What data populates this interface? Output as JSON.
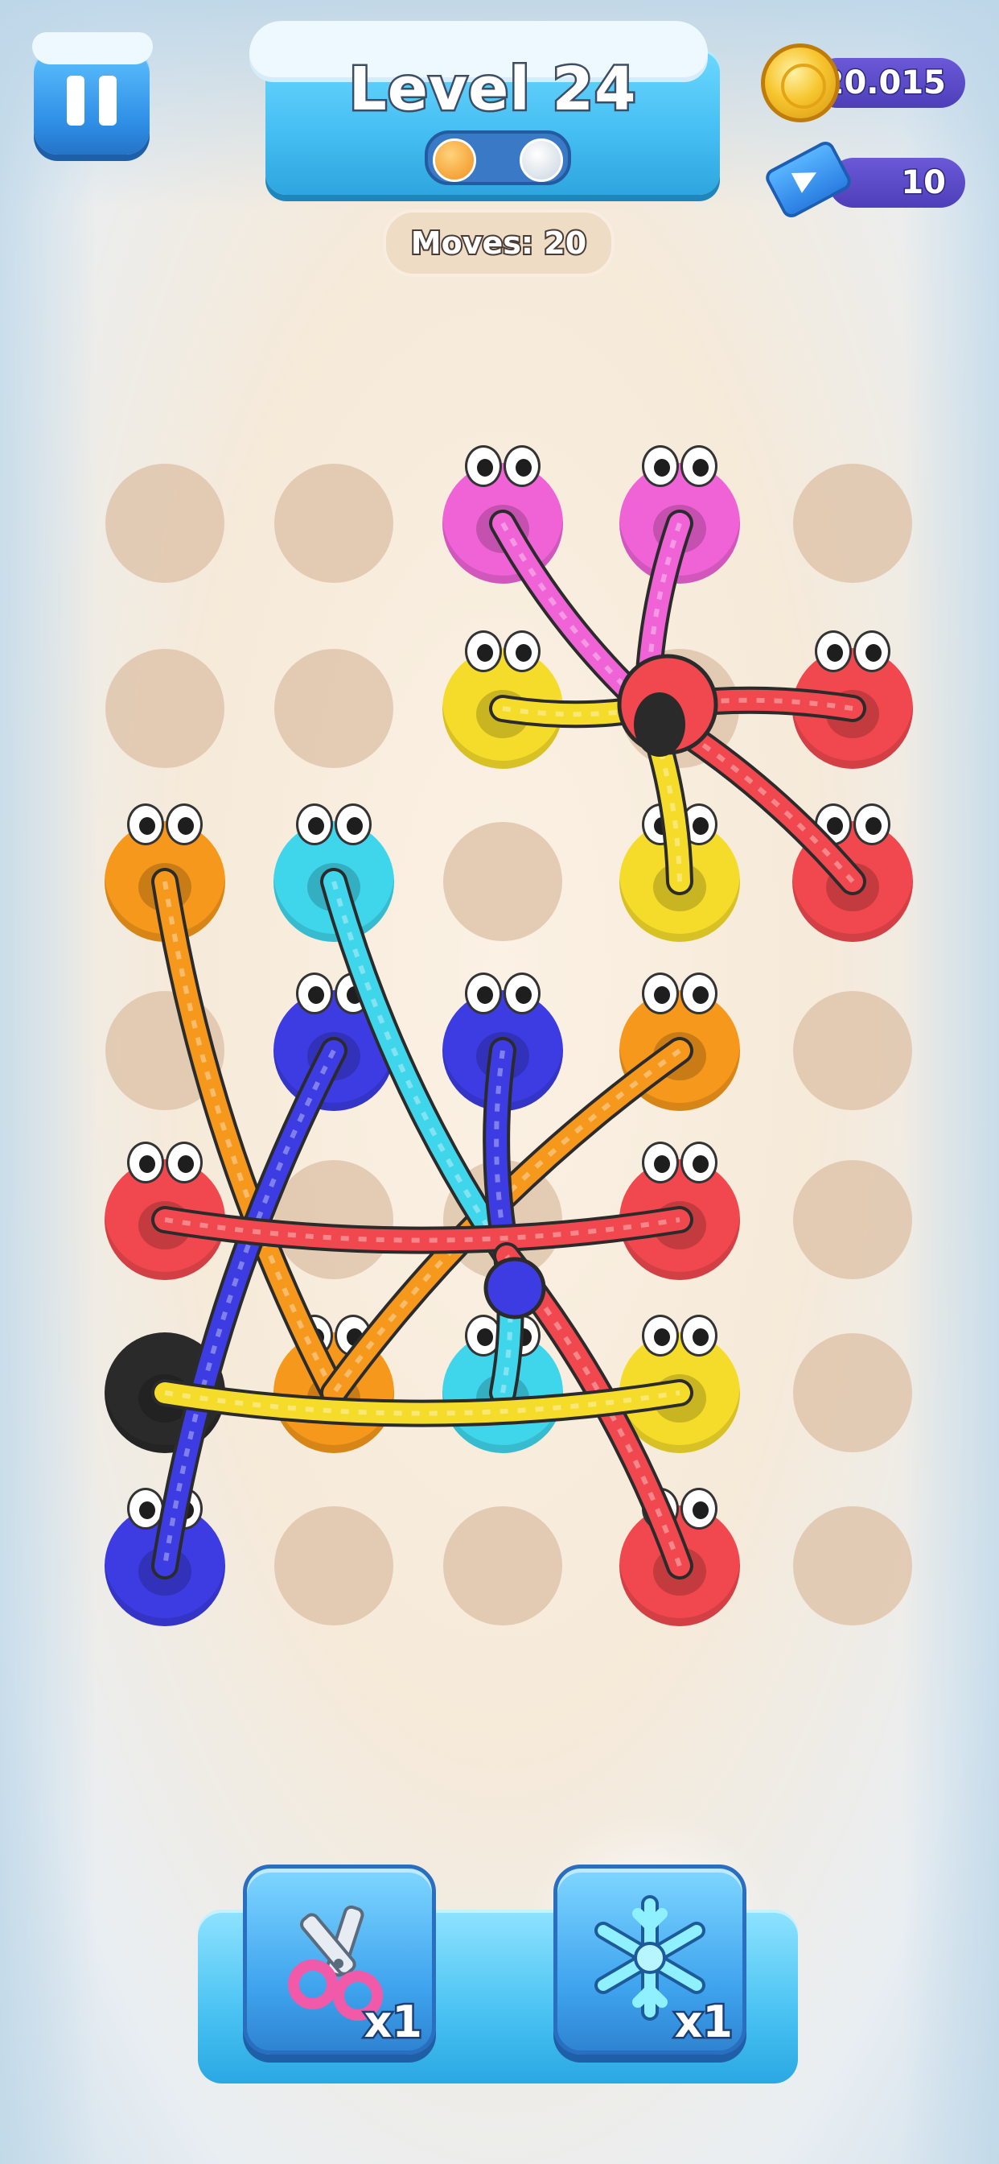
{
  "hud": {
    "level_label": "Level 24",
    "level_progress": {
      "completed": 1,
      "total": 2
    },
    "moves_label": "Moves: 20",
    "coins": "20.015",
    "tickets": "10"
  },
  "colors": {
    "pink": "#f063d6",
    "yellow": "#f6dc2a",
    "red": "#f0484e",
    "orange": "#f6981c",
    "cyan": "#3fd6ec",
    "blue": "#3c3ce2",
    "black": "#2a2a2a",
    "hole": "#dfc6ac"
  },
  "board": {
    "rows": 7,
    "cols": 5,
    "pegs": [
      {
        "row": 0,
        "col": 2,
        "color": "pink",
        "eyes": true
      },
      {
        "row": 0,
        "col": 3,
        "color": "pink",
        "eyes": true
      },
      {
        "row": 1,
        "col": 2,
        "color": "yellow",
        "eyes": true
      },
      {
        "row": 1,
        "col": 4,
        "color": "red",
        "eyes": true
      },
      {
        "row": 2,
        "col": 0,
        "color": "orange",
        "eyes": true
      },
      {
        "row": 2,
        "col": 1,
        "color": "cyan",
        "eyes": true
      },
      {
        "row": 2,
        "col": 3,
        "color": "yellow",
        "eyes": true
      },
      {
        "row": 2,
        "col": 4,
        "color": "red",
        "eyes": true
      },
      {
        "row": 3,
        "col": 1,
        "color": "blue",
        "eyes": true
      },
      {
        "row": 3,
        "col": 2,
        "color": "blue",
        "eyes": true
      },
      {
        "row": 3,
        "col": 3,
        "color": "orange",
        "eyes": true
      },
      {
        "row": 4,
        "col": 0,
        "color": "red",
        "eyes": true
      },
      {
        "row": 4,
        "col": 3,
        "color": "red",
        "eyes": true
      },
      {
        "row": 5,
        "col": 0,
        "color": "black",
        "eyes": false
      },
      {
        "row": 5,
        "col": 1,
        "color": "orange",
        "eyes": true
      },
      {
        "row": 5,
        "col": 2,
        "color": "cyan",
        "eyes": true
      },
      {
        "row": 5,
        "col": 3,
        "color": "yellow",
        "eyes": true
      },
      {
        "row": 6,
        "col": 0,
        "color": "blue",
        "eyes": true
      },
      {
        "row": 6,
        "col": 3,
        "color": "red",
        "eyes": true
      }
    ],
    "ropes": [
      {
        "from": [
          0,
          2
        ],
        "to": "knot_top",
        "color": "pink"
      },
      {
        "from": [
          0,
          3
        ],
        "to": "knot_top",
        "color": "pink"
      },
      {
        "from": [
          1,
          2
        ],
        "to": "knot_top",
        "color": "yellow"
      },
      {
        "from": [
          2,
          3
        ],
        "to": "knot_top",
        "color": "yellow"
      },
      {
        "from": [
          1,
          4
        ],
        "to": "knot_top",
        "color": "red"
      },
      {
        "from": [
          2,
          4
        ],
        "to": "knot_top",
        "color": "red"
      },
      {
        "from": [
          2,
          0
        ],
        "to": [
          5,
          1
        ],
        "color": "orange"
      },
      {
        "from": [
          3,
          3
        ],
        "to": [
          5,
          1
        ],
        "color": "orange"
      },
      {
        "from": [
          2,
          1
        ],
        "to": "knot_mid",
        "color": "cyan"
      },
      {
        "from": [
          5,
          2
        ],
        "to": "knot_mid",
        "color": "cyan"
      },
      {
        "from": [
          3,
          1
        ],
        "to": [
          6,
          0
        ],
        "color": "blue"
      },
      {
        "from": [
          3,
          2
        ],
        "to": "knot_mid",
        "color": "blue"
      },
      {
        "from": [
          4,
          0
        ],
        "to": [
          4,
          3
        ],
        "color": "red"
      },
      {
        "from": [
          6,
          3
        ],
        "to": "knot_mid",
        "color": "red"
      },
      {
        "from": [
          5,
          0
        ],
        "to": [
          5,
          3
        ],
        "color": "yellow"
      }
    ]
  },
  "tools": [
    {
      "name": "scissors",
      "count": "x1"
    },
    {
      "name": "freeze",
      "count": "x1"
    }
  ]
}
